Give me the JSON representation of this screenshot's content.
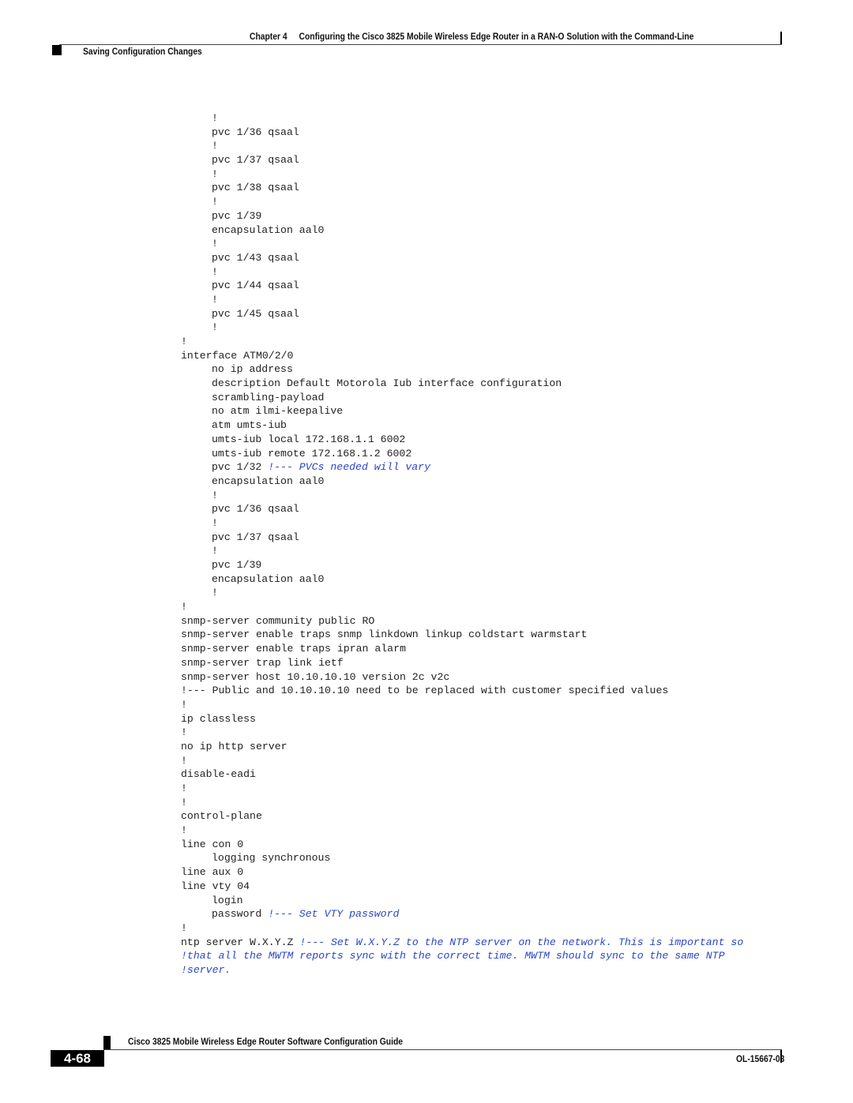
{
  "header": {
    "chapter": "Chapter 4",
    "chapter_title": "Configuring the Cisco 3825 Mobile Wireless Edge Router in a RAN-O Solution with the Command-Line",
    "section": "Saving Configuration Changes"
  },
  "code_lines": [
    {
      "indent": 1,
      "text": "!",
      "comment": ""
    },
    {
      "indent": 1,
      "text": "pvc 1/36 qsaal",
      "comment": ""
    },
    {
      "indent": 1,
      "text": "!",
      "comment": ""
    },
    {
      "indent": 1,
      "text": "pvc 1/37 qsaal",
      "comment": ""
    },
    {
      "indent": 1,
      "text": "!",
      "comment": ""
    },
    {
      "indent": 1,
      "text": "pvc 1/38 qsaal",
      "comment": ""
    },
    {
      "indent": 1,
      "text": "!",
      "comment": ""
    },
    {
      "indent": 1,
      "text": "pvc 1/39",
      "comment": ""
    },
    {
      "indent": 1,
      "text": "encapsulation aal0",
      "comment": ""
    },
    {
      "indent": 1,
      "text": "!",
      "comment": ""
    },
    {
      "indent": 1,
      "text": "pvc 1/43 qsaal",
      "comment": ""
    },
    {
      "indent": 1,
      "text": "!",
      "comment": ""
    },
    {
      "indent": 1,
      "text": "pvc 1/44 qsaal",
      "comment": ""
    },
    {
      "indent": 1,
      "text": "!",
      "comment": ""
    },
    {
      "indent": 1,
      "text": "pvc 1/45 qsaal",
      "comment": ""
    },
    {
      "indent": 1,
      "text": "!",
      "comment": ""
    },
    {
      "indent": 0,
      "text": "!",
      "comment": ""
    },
    {
      "indent": 0,
      "text": "interface ATM0/2/0",
      "comment": ""
    },
    {
      "indent": 1,
      "text": "no ip address",
      "comment": ""
    },
    {
      "indent": 1,
      "text": "description Default Motorola Iub interface configuration",
      "comment": ""
    },
    {
      "indent": 1,
      "text": "scrambling-payload",
      "comment": ""
    },
    {
      "indent": 1,
      "text": "no atm ilmi-keepalive",
      "comment": ""
    },
    {
      "indent": 1,
      "text": "atm umts-iub",
      "comment": ""
    },
    {
      "indent": 1,
      "text": "umts-iub local 172.168.1.1 6002",
      "comment": ""
    },
    {
      "indent": 1,
      "text": "umts-iub remote 172.168.1.2 6002",
      "comment": ""
    },
    {
      "indent": 1,
      "text": "pvc 1/32 ",
      "comment": "!--- PVCs needed will vary"
    },
    {
      "indent": 1,
      "text": "encapsulation aal0",
      "comment": ""
    },
    {
      "indent": 1,
      "text": "!",
      "comment": ""
    },
    {
      "indent": 1,
      "text": "pvc 1/36 qsaal",
      "comment": ""
    },
    {
      "indent": 1,
      "text": "!",
      "comment": ""
    },
    {
      "indent": 1,
      "text": "pvc 1/37 qsaal",
      "comment": ""
    },
    {
      "indent": 1,
      "text": "!",
      "comment": ""
    },
    {
      "indent": 1,
      "text": "pvc 1/39",
      "comment": ""
    },
    {
      "indent": 1,
      "text": "encapsulation aal0",
      "comment": ""
    },
    {
      "indent": 1,
      "text": "!",
      "comment": ""
    },
    {
      "indent": 0,
      "text": "!",
      "comment": ""
    },
    {
      "indent": 0,
      "text": "snmp-server community public RO",
      "comment": ""
    },
    {
      "indent": 0,
      "text": "snmp-server enable traps snmp linkdown linkup coldstart warmstart",
      "comment": ""
    },
    {
      "indent": 0,
      "text": "snmp-server enable traps ipran alarm",
      "comment": ""
    },
    {
      "indent": 0,
      "text": "snmp-server trap link ietf",
      "comment": ""
    },
    {
      "indent": 0,
      "text": "snmp-server host 10.10.10.10 version 2c v2c",
      "comment": ""
    },
    {
      "indent": 0,
      "text": "!--- Public and 10.10.10.10 need to be replaced with customer specified values",
      "comment": ""
    },
    {
      "indent": 0,
      "text": "!",
      "comment": ""
    },
    {
      "indent": 0,
      "text": "ip classless",
      "comment": ""
    },
    {
      "indent": 0,
      "text": "!",
      "comment": ""
    },
    {
      "indent": 0,
      "text": "no ip http server",
      "comment": ""
    },
    {
      "indent": 0,
      "text": "!",
      "comment": ""
    },
    {
      "indent": 0,
      "text": "disable-eadi",
      "comment": ""
    },
    {
      "indent": 0,
      "text": "!",
      "comment": ""
    },
    {
      "indent": 0,
      "text": "!",
      "comment": ""
    },
    {
      "indent": 0,
      "text": "control-plane",
      "comment": ""
    },
    {
      "indent": 0,
      "text": "!",
      "comment": ""
    },
    {
      "indent": 0,
      "text": "line con 0",
      "comment": ""
    },
    {
      "indent": 1,
      "text": "logging synchronous",
      "comment": ""
    },
    {
      "indent": 0,
      "text": "line aux 0",
      "comment": ""
    },
    {
      "indent": 0,
      "text": "line vty 04",
      "comment": ""
    },
    {
      "indent": 1,
      "text": "login",
      "comment": ""
    },
    {
      "indent": 1,
      "text": "password ",
      "comment": "!--- Set VTY password"
    },
    {
      "indent": 0,
      "text": "!",
      "comment": ""
    },
    {
      "indent": 0,
      "text": "ntp server W.X.Y.Z ",
      "comment": "!--- Set W.X.Y.Z to the NTP server on the network. This is important so"
    },
    {
      "indent": 0,
      "text": "",
      "comment": "!that all the MWTM reports sync with the correct time. MWTM should sync to the same NTP"
    },
    {
      "indent": 0,
      "text": "",
      "comment": "!server."
    }
  ],
  "footer": {
    "guide_title": "Cisco 3825 Mobile Wireless Edge Router Software Configuration Guide",
    "page_number": "4-68",
    "doc_id": "OL-15667-03"
  },
  "colors": {
    "comment": "#2b45c9",
    "text": "#222222"
  }
}
